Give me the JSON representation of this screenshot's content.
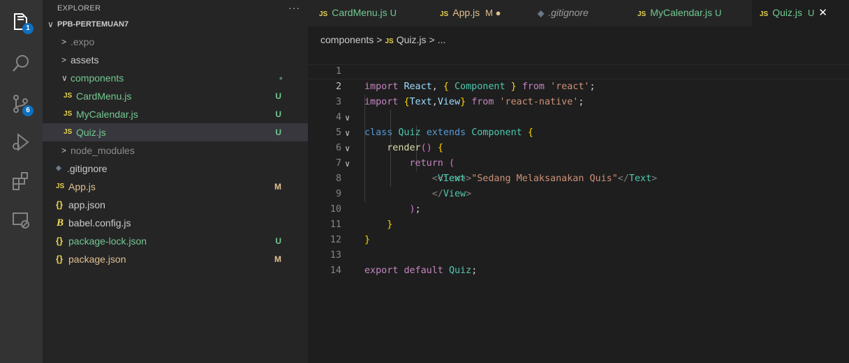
{
  "activity_bar": {
    "explorer_badge": "1",
    "scm_badge": "6"
  },
  "sidebar": {
    "title": "EXPLORER",
    "more": "···",
    "project": "PPB-PERTEMUAN7",
    "tree": [
      {
        "label": ".expo",
        "chevron": ">",
        "status": ""
      },
      {
        "label": "assets",
        "chevron": ">",
        "status": ""
      },
      {
        "label": "components",
        "chevron": "∨",
        "status": "●"
      },
      {
        "label": "CardMenu.js",
        "icon": "JS",
        "status": "U"
      },
      {
        "label": "MyCalendar.js",
        "icon": "JS",
        "status": "U"
      },
      {
        "label": "Quiz.js",
        "icon": "JS",
        "status": "U"
      },
      {
        "label": "node_modules",
        "chevron": ">",
        "status": ""
      },
      {
        "label": ".gitignore",
        "icon": "◈",
        "status": ""
      },
      {
        "label": "App.js",
        "icon": "JS",
        "status": "M"
      },
      {
        "label": "app.json",
        "icon": "{}",
        "status": ""
      },
      {
        "label": "babel.config.js",
        "icon": "B",
        "status": ""
      },
      {
        "label": "package-lock.json",
        "icon": "{}",
        "status": "U"
      },
      {
        "label": "package.json",
        "icon": "{}",
        "status": "M"
      }
    ]
  },
  "tabs": [
    {
      "icon": "JS",
      "name": "CardMenu.js",
      "status": "U"
    },
    {
      "icon": "JS",
      "name": "App.js",
      "status": "M ●"
    },
    {
      "icon": "◈",
      "name": ".gitignore",
      "status": ""
    },
    {
      "icon": "JS",
      "name": "MyCalendar.js",
      "status": "U"
    },
    {
      "icon": "JS",
      "name": "Quiz.js",
      "status": "U",
      "close": "✕"
    }
  ],
  "breadcrumb": {
    "folder": "components",
    "sep": ">",
    "icon": "JS",
    "file": "Quiz.js",
    "symbol": "..."
  },
  "editor": {
    "line_numbers": [
      "1",
      "2",
      "3",
      "4",
      "5",
      "6",
      "7",
      "8",
      "9",
      "10",
      "11",
      "12",
      "13",
      "14"
    ],
    "lines": [
      "import React, { Component } from 'react';",
      "import {Text,View} from 'react-native';",
      "class Quiz extends Component {",
      "    render() {",
      "        return (",
      "            <View>",
      "             <Text>\"Sedang Melaksanakan Quis\"</Text>",
      "            </View>",
      "        );",
      "    }",
      "}",
      "",
      "export default Quiz;",
      ""
    ]
  },
  "colors": {
    "activity_bg": "#333333",
    "sidebar_bg": "#252526",
    "editor_bg": "#1e1e1e",
    "badge": "#0e70c0",
    "untracked": "#73c991",
    "modified": "#e2c08d"
  }
}
